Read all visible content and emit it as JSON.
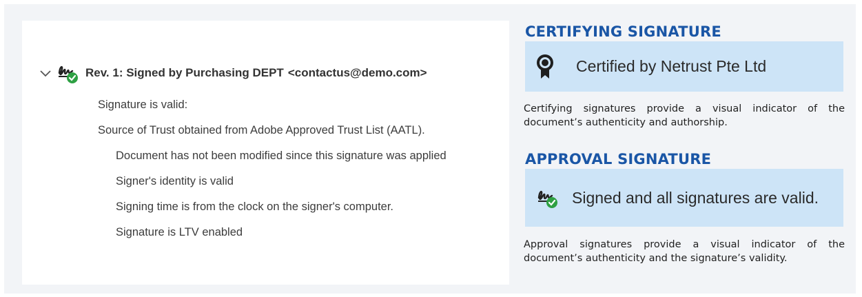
{
  "left_panel": {
    "revision_title": "Rev. 1: Signed by Purchasing DEPT",
    "revision_email": "<contactus@demo.com>",
    "details": [
      "Signature is valid:",
      "Source of Trust obtained from Adobe Approved Trust List (AATL).",
      "Document has not been modified since this signature was applied",
      "Signer's identity is valid",
      "Signing time is from the clock on the signer's computer.",
      "Signature is LTV enabled"
    ],
    "icons": [
      "chevron-down-icon",
      "signature-valid-icon"
    ]
  },
  "certifying": {
    "heading": "CERTIFYING SIGNATURE",
    "banner_text": "Certified by Netrust Pte Ltd",
    "banner_icon": "certificate-ribbon-icon",
    "description": "Certifying signatures provide a visual indicator of the document’s authenticity and authorship."
  },
  "approval": {
    "heading": "APPROVAL SIGNATURE",
    "banner_text": "Signed and all signatures are valid.",
    "banner_icon": "signature-valid-icon",
    "description": "Approval signatures provide a visual indicator of the document’s authenticity and the signature’s validity."
  },
  "colors": {
    "heading_blue": "#1a56a6",
    "banner_bg": "#cde4f7",
    "check_green": "#2ea043",
    "frame_bg": "#f2f4f7"
  }
}
